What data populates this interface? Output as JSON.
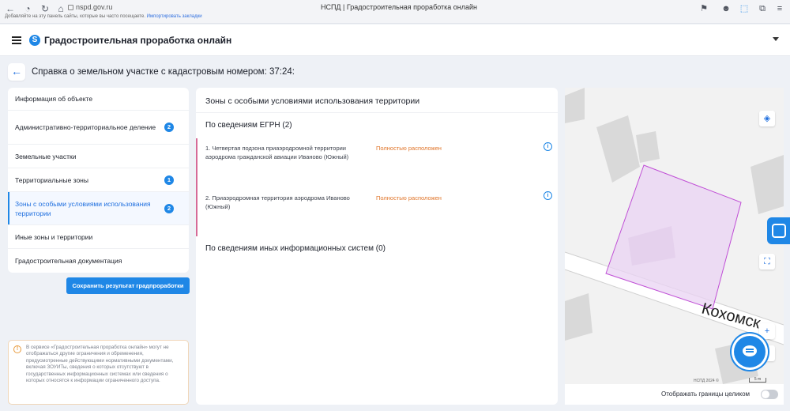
{
  "browser": {
    "url": "nspd.gov.ru",
    "tab_title": "НСПД | Градостроительная проработка онлайн",
    "bookmarks_text": "Добавляйте на эту панель сайты, которые вы часто посещаете.",
    "bookmarks_link": "Импортировать закладки"
  },
  "app": {
    "title": "Градостроительная проработка онлайн",
    "logo_glyph": "S"
  },
  "page": {
    "back_glyph": "←",
    "title": "Справка о земельном участке с кадастровым номером: 37:24:"
  },
  "menu": {
    "items": [
      {
        "label": "Информация об объекте",
        "badge": null
      },
      {
        "label": "Административно-территориальное деление",
        "badge": "2"
      },
      {
        "label": "Земельные участки",
        "badge": null
      },
      {
        "label": "Территориальные зоны",
        "badge": "1"
      },
      {
        "label": "Зоны с особыми условиями использования территории",
        "badge": "2",
        "active": true
      },
      {
        "label": "Иные зоны и территории",
        "badge": null
      },
      {
        "label": "Градостроительная документация",
        "badge": null
      }
    ],
    "save_button": "Сохранить результат градпроработки"
  },
  "notice": {
    "icon": "!",
    "text": "В сервисе «Градостроительная проработка онлайн» могут не отображаться другие ограничения и обременения, предусмотренные действующими нормативными документами, включая ЗОУИТы, сведения о которых отсутствуют в государственных информационных системах или сведения о которых относятся к информации ограниченного доступа."
  },
  "zones_panel": {
    "title": "Зоны с особыми условиями использования территории",
    "egrn_heading": "По сведениям ЕГРН (2)",
    "zones": [
      {
        "name": "1. Четвертая подзона приаэродромной территории аэродрома гражданской авиации Иваново (Южный)",
        "status": "Полностью расположен"
      },
      {
        "name": "2. Приаэродромная территория аэродрома Иваново (Южный)",
        "status": "Полностью расположен"
      }
    ],
    "other_heading": "По сведениям иных информационных систем (0)",
    "info_glyph": "i"
  },
  "map": {
    "street_label": "Кохомск",
    "copyright": "НСПД 2024 ©",
    "scale": "5 m",
    "zoom_in": "+",
    "zoom_out": "−",
    "fullscreen_glyph": "⛶",
    "layers_glyph": "◈",
    "toggle_label": "Отображать границы целиком",
    "toggle_on": false,
    "colors": {
      "parcel_stroke": "#c04fd6",
      "parcel_fill": "#e9d3f3",
      "building": "#d9d9d9",
      "road": "#ffffff"
    }
  },
  "colors": {
    "accent": "#1f87e6",
    "status_orange": "#e0752a",
    "zone_bar": "#d66a96"
  }
}
